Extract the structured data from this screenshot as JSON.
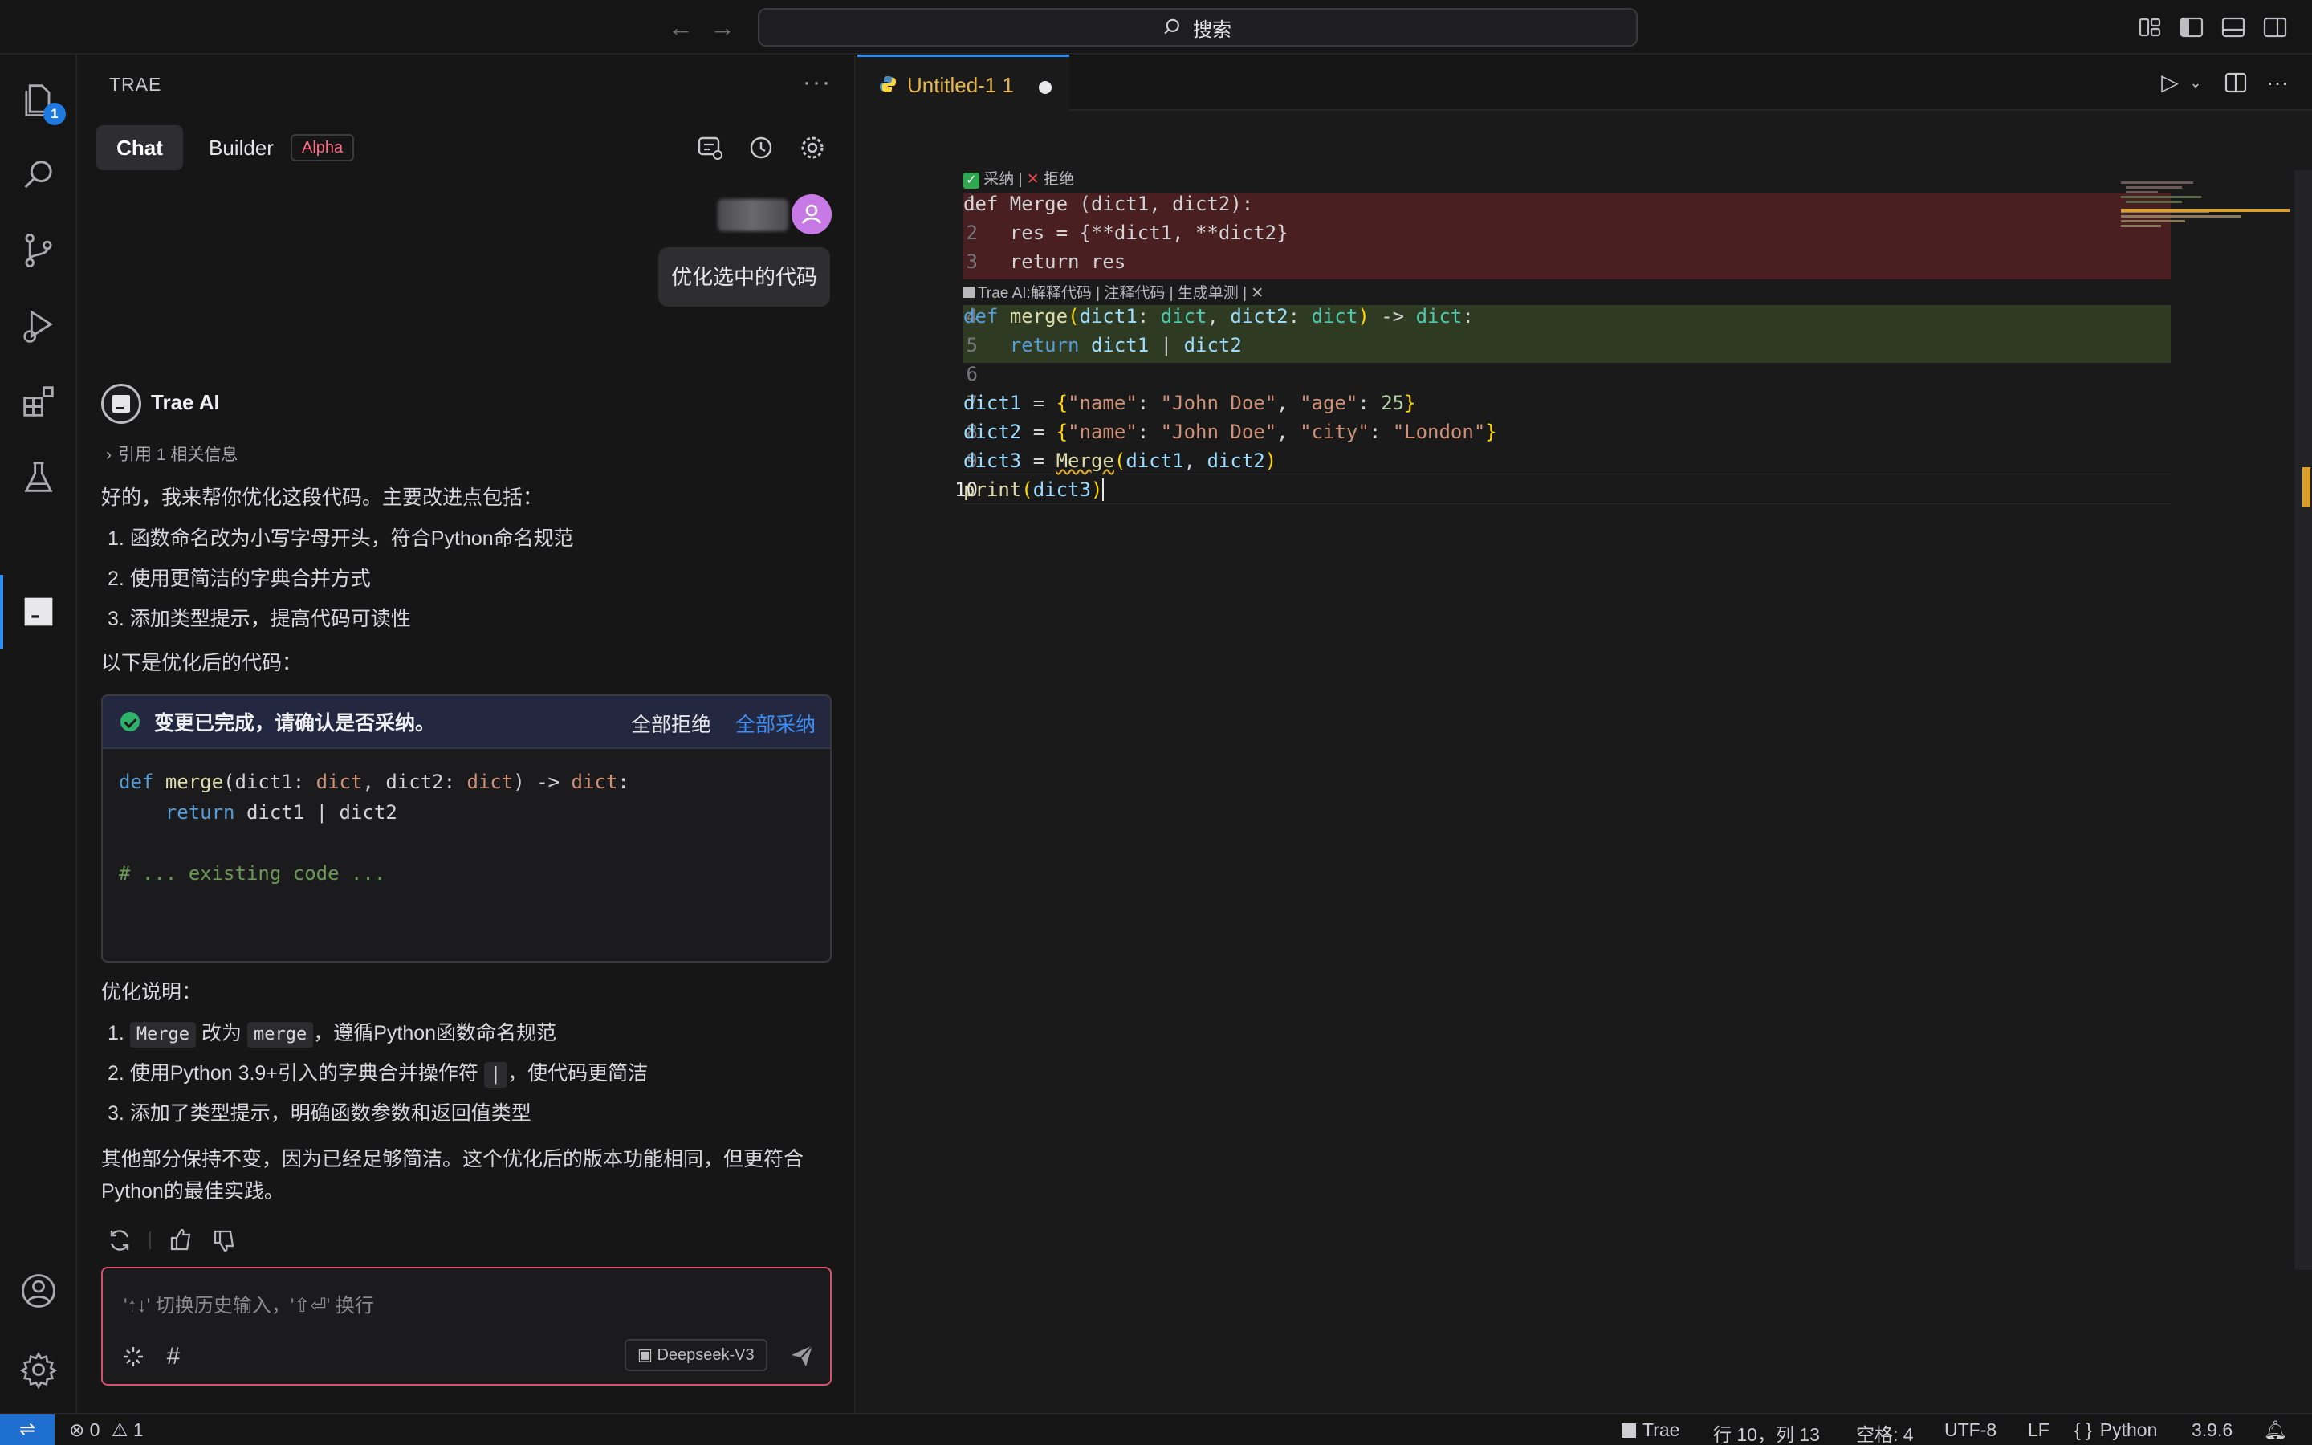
{
  "titlebar": {
    "search_label": "搜索",
    "back_icon": "arrow-left-icon",
    "forward_icon": "arrow-right-icon"
  },
  "activity_bar": {
    "explorer_badge": "1",
    "items": [
      "explorer-icon",
      "search-icon",
      "source-control-icon",
      "run-debug-icon",
      "extensions-icon",
      "testing-icon",
      "trae-ai-icon"
    ],
    "bottom": [
      "account-icon",
      "settings-gear-icon"
    ]
  },
  "panel": {
    "title": "TRAE",
    "more": "···",
    "tab_chat": "Chat",
    "tab_builder": "Builder",
    "alpha_badge": "Alpha",
    "user_message": "优化选中的代码",
    "ai_name": "Trae AI",
    "reference": "引用 1 相关信息",
    "intro": "好的，我来帮你优化这段代码。主要改进点包括：",
    "points": [
      "1. 函数命名改为小写字母开头，符合Python命名规范",
      "2. 使用更简洁的字典合并方式",
      "3. 添加类型提示，提高代码可读性"
    ],
    "after_label": "以下是优化后的代码：",
    "card": {
      "title": "变更已完成，请确认是否采纳。",
      "reject_all": "全部拒绝",
      "accept_all": "全部采纳",
      "code_comment": "# ... existing code ..."
    },
    "explain_label": "优化说明：",
    "explain": {
      "p1_num": "1.",
      "p1_code_a": "Merge",
      "p1_mid": "改为",
      "p1_code_b": "merge",
      "p1_tail": "，遵循Python函数命名规范",
      "p2_head": "2. 使用Python 3.9+引入的字典合并操作符",
      "p2_code": "|",
      "p2_tail": "，使代码更简洁",
      "p3": "3. 添加了类型提示，明确函数参数和返回值类型"
    },
    "closing": "其他部分保持不变，因为已经足够简洁。这个优化后的版本功能相同，但更符合Python的最佳实践。",
    "input_placeholder": "'↑↓' 切换历史输入，'⇧⏎' 换行",
    "hash_symbol": "#",
    "model": "Deepseek-V3"
  },
  "editor": {
    "tab_title": "Untitled-1 1",
    "accept_label": "采纳",
    "reject_label": "拒绝",
    "separator": "|",
    "code_lens": "Trae AI:解释代码 | 注释代码 | 生成单测 | ✕",
    "line_numbers": [
      "1",
      "2",
      "3",
      "4",
      "5",
      "6",
      "7",
      "8",
      "9",
      "10"
    ]
  },
  "statusbar": {
    "errors": "0",
    "warnings": "1",
    "brand": "Trae",
    "position": "行 10，列 13",
    "spaces": "空格: 4",
    "encoding": "UTF-8",
    "eol": "LF",
    "language": "Python",
    "python_version": "3.9.6"
  },
  "colors": {
    "accent": "#2d8cf0",
    "deleted_bg": "#4a1f22",
    "added_bg": "#2f3a22",
    "input_border": "#d6506c",
    "alpha": "#ff6b8a"
  }
}
